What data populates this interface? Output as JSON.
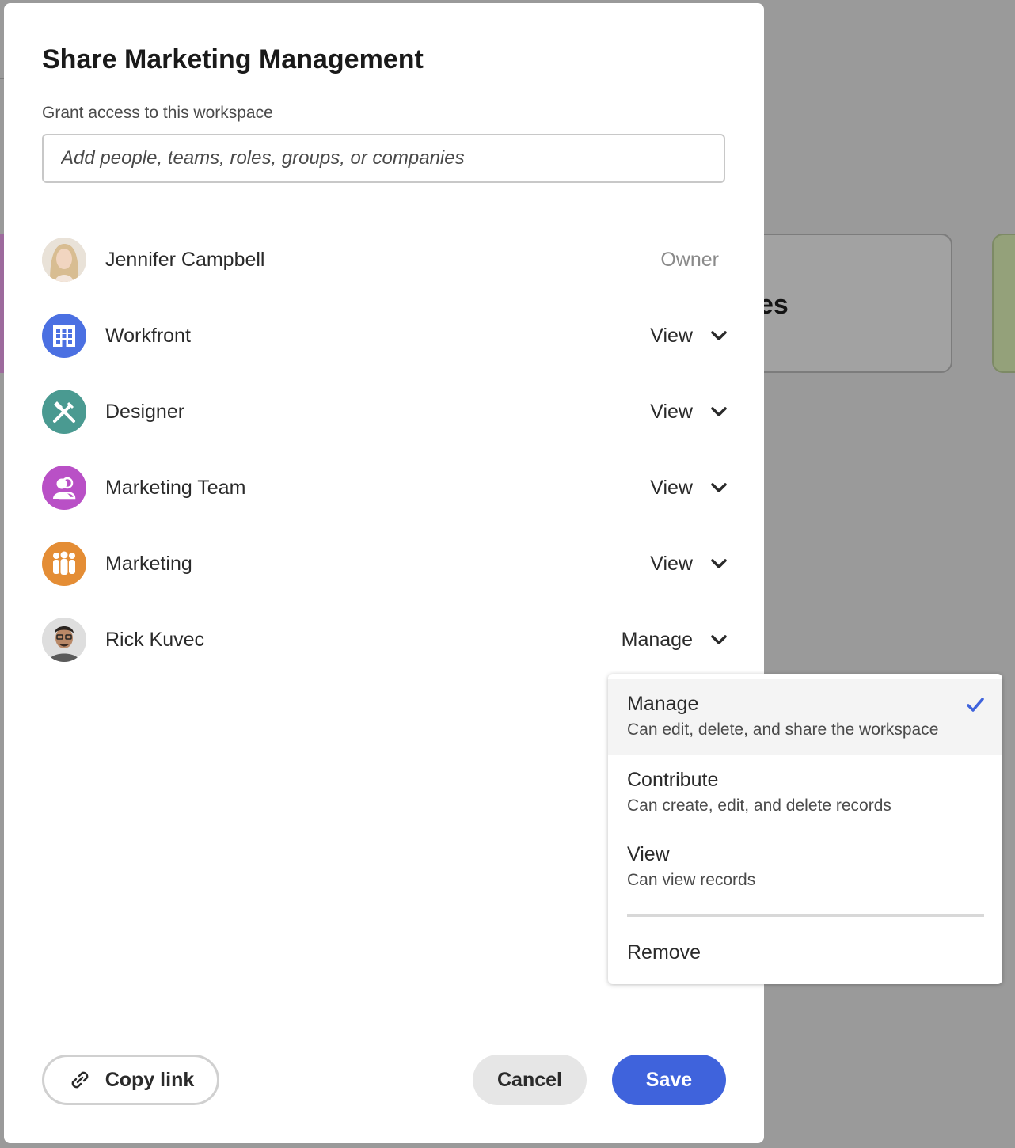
{
  "background": {
    "card_text": "es"
  },
  "dialog": {
    "title": "Share Marketing Management",
    "field_label": "Grant access to this workspace",
    "search_placeholder": "Add people, teams, roles, groups, or companies"
  },
  "members": [
    {
      "name": "Jennifer Campbell",
      "permission": "Owner",
      "avatar": "photo",
      "color": "#d9c1a4"
    },
    {
      "name": "Workfront",
      "permission": "View",
      "avatar": "company-icon",
      "color": "#4b70e2"
    },
    {
      "name": "Designer",
      "permission": "View",
      "avatar": "role-icon",
      "color": "#4a9a91"
    },
    {
      "name": "Marketing Team",
      "permission": "View",
      "avatar": "team-icon",
      "color": "#b950c6"
    },
    {
      "name": "Marketing",
      "permission": "View",
      "avatar": "group-icon",
      "color": "#e48d35"
    },
    {
      "name": "Rick Kuvec",
      "permission": "Manage",
      "avatar": "photo",
      "color": "#6c6c6c"
    }
  ],
  "permission_menu": {
    "options": [
      {
        "label": "Manage",
        "description": "Can edit, delete, and share the workspace",
        "selected": true
      },
      {
        "label": "Contribute",
        "description": "Can create, edit, and delete records",
        "selected": false
      },
      {
        "label": "View",
        "description": "Can view records",
        "selected": false
      }
    ],
    "remove_label": "Remove",
    "check_color": "#3f63dc"
  },
  "footer": {
    "copy_link": "Copy link",
    "cancel": "Cancel",
    "save": "Save",
    "save_color": "#3f63dc"
  }
}
